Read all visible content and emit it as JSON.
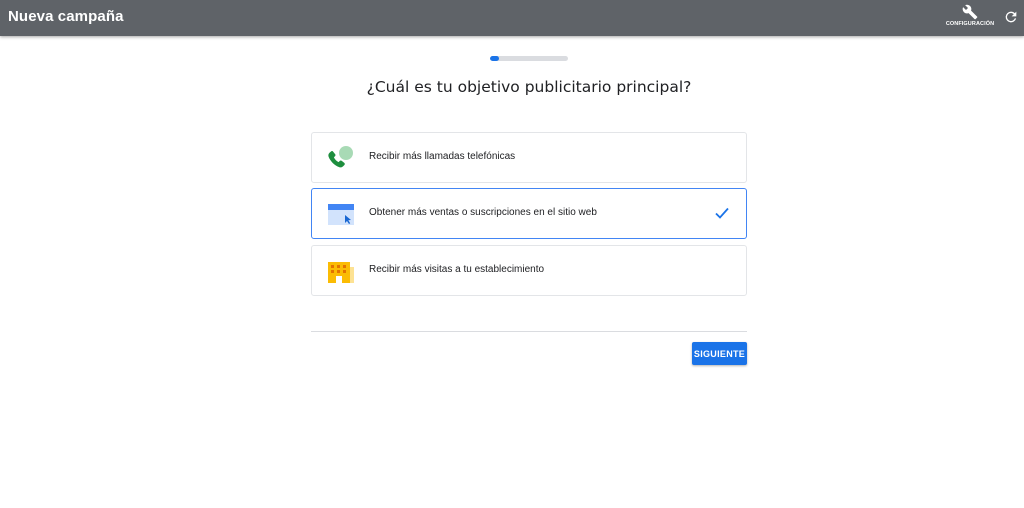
{
  "header": {
    "title": "Nueva campaña",
    "config_label": "CONFIGURACIÓN",
    "config_icon": "wrench-icon",
    "refresh_icon": "refresh-icon"
  },
  "progress": {
    "fraction": 0.12
  },
  "question": "¿Cuál es tu objetivo publicitario principal?",
  "options": [
    {
      "label": "Recibir más llamadas telefónicas",
      "icon": "phone-call-icon",
      "selected": false
    },
    {
      "label": "Obtener más ventas o suscripciones en el sitio web",
      "icon": "website-icon",
      "selected": true
    },
    {
      "label": "Recibir más visitas a tu establecimiento",
      "icon": "store-building-icon",
      "selected": false
    }
  ],
  "next_label": "SIGUIENTE",
  "colors": {
    "header_bg": "#5f6368",
    "accent": "#1a73e8",
    "selected_border": "#4285f4",
    "phone_green": "#1e8e3e",
    "building_yellow": "#fbbc04"
  }
}
